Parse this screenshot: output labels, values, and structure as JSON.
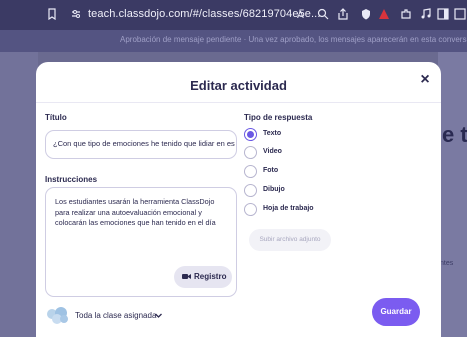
{
  "browser": {
    "url": "teach.classdojo.com/#/classes/68219704e5e..."
  },
  "background": {
    "banner_text": "Aprobación de mensaje pendiente · Una vez aprobado, los mensajes aparecerán en esta conversación",
    "big_text": "e te",
    "side_text": "ntes"
  },
  "modal": {
    "title": "Editar actividad",
    "close_symbol": "×"
  },
  "form": {
    "title_label": "Título",
    "title_value": "¿Con que tipo de emociones he tenido que lidiar en es",
    "instructions_label": "Instrucciones",
    "instructions_value": "Los estudiantes usarán la herramienta ClassDojo para realizar una autoevaluación emocional y colocarán las emociones que han tenido en el día",
    "record_label": "Registro",
    "response_type_label": "Tipo de respuesta",
    "response_options": [
      {
        "label": "Texto",
        "selected": true
      },
      {
        "label": "Video",
        "selected": false
      },
      {
        "label": "Foto",
        "selected": false
      },
      {
        "label": "Dibujo",
        "selected": false
      },
      {
        "label": "Hoja de trabajo",
        "selected": false
      }
    ],
    "upload_label": "Subir archivo adjunto",
    "assign_label": "Toda la clase asignada",
    "save_label": "Guardar"
  },
  "colors": {
    "accent": "#7b5cf0",
    "radio_selected": "#6a58e4",
    "text": "#2c2a50"
  }
}
